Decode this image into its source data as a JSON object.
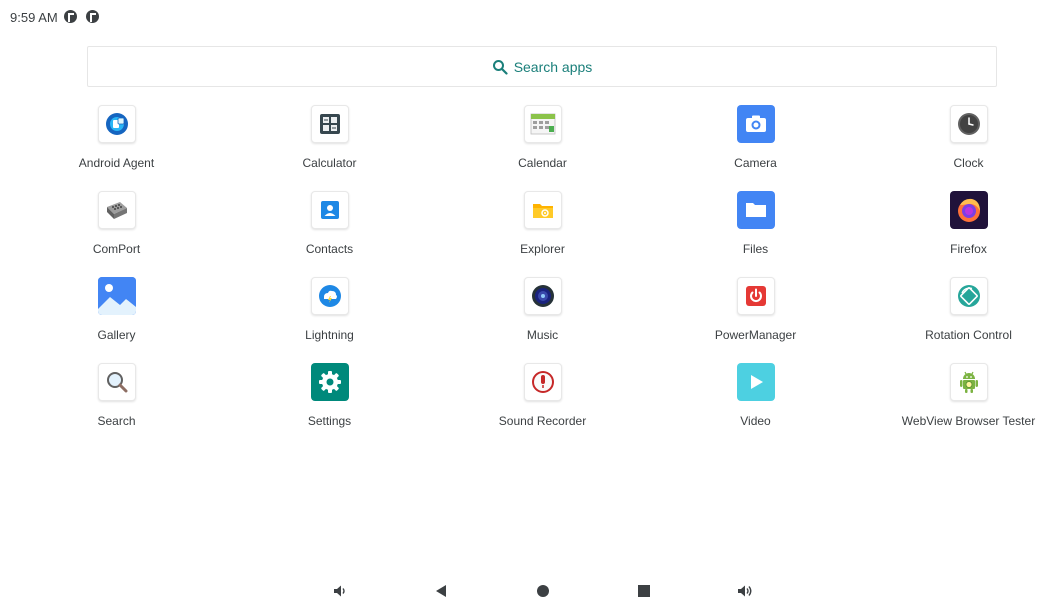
{
  "status_bar": {
    "time": "9:59 AM",
    "icons": [
      "notification-app-icon",
      "notification-app-icon"
    ]
  },
  "search": {
    "label": "Search apps",
    "icon": "search-icon",
    "accent_color": "#1a7f7a"
  },
  "apps": [
    {
      "label": "Android Agent",
      "icon": "android-agent-icon"
    },
    {
      "label": "Calculator",
      "icon": "calculator-icon"
    },
    {
      "label": "Calendar",
      "icon": "calendar-icon"
    },
    {
      "label": "Camera",
      "icon": "camera-icon"
    },
    {
      "label": "Clock",
      "icon": "clock-icon"
    },
    {
      "label": "ComPort",
      "icon": "comport-icon"
    },
    {
      "label": "Contacts",
      "icon": "contacts-icon"
    },
    {
      "label": "Explorer",
      "icon": "explorer-icon"
    },
    {
      "label": "Files",
      "icon": "files-icon"
    },
    {
      "label": "Firefox",
      "icon": "firefox-icon"
    },
    {
      "label": "Gallery",
      "icon": "gallery-icon"
    },
    {
      "label": "Lightning",
      "icon": "lightning-icon"
    },
    {
      "label": "Music",
      "icon": "music-icon"
    },
    {
      "label": "PowerManager",
      "icon": "power-manager-icon"
    },
    {
      "label": "Rotation Control",
      "icon": "rotation-control-icon"
    },
    {
      "label": "Search",
      "icon": "search-app-icon"
    },
    {
      "label": "Settings",
      "icon": "settings-icon"
    },
    {
      "label": "Sound Recorder",
      "icon": "sound-recorder-icon"
    },
    {
      "label": "Video",
      "icon": "video-icon"
    },
    {
      "label": "WebView Browser Tester",
      "icon": "webview-browser-tester-icon"
    }
  ],
  "nav_bar": {
    "buttons": [
      "volume-down-icon",
      "back-icon",
      "home-icon",
      "recents-icon",
      "volume-up-icon"
    ]
  }
}
